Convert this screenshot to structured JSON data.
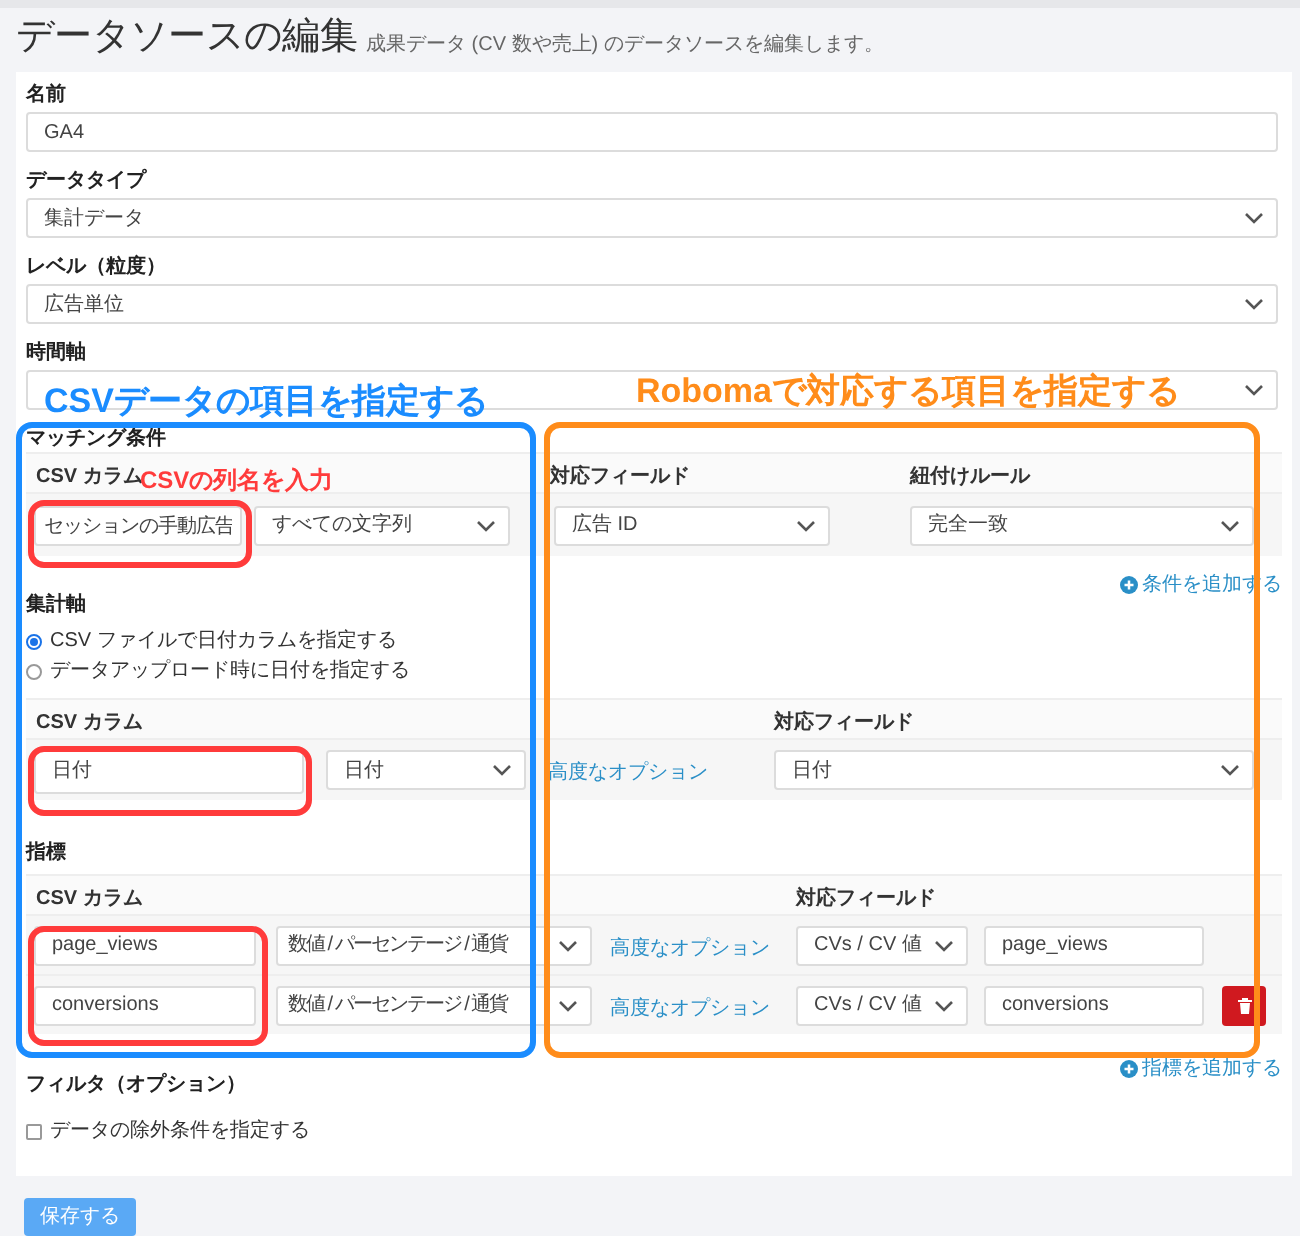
{
  "page": {
    "title": "データソースの編集",
    "subtitle": "成果データ (CV 数や売上) のデータソースを編集します。"
  },
  "fields": [
    {
      "label": "名前",
      "kind": "input",
      "value": "GA4"
    },
    {
      "label": "データタイプ",
      "kind": "select",
      "value": "集計データ"
    },
    {
      "label": "レベル（粒度）",
      "kind": "select",
      "value": "広告単位"
    },
    {
      "label": "時間軸",
      "kind": "select"
    }
  ],
  "matching": {
    "label": "マッチング条件",
    "columns": [
      "CSV カラム",
      "対応フィールド",
      "紐付けルール"
    ],
    "row": {
      "csv_column": "セッションの手動広告",
      "csv_type": "すべての文字列",
      "field": "広告 ID",
      "rule": "完全一致"
    },
    "add_link": "条件を追加する"
  },
  "aggregation": {
    "label": "集計軸",
    "options": [
      {
        "label": "CSV ファイルで日付カラムを指定する",
        "selected": true
      },
      {
        "label": "データアップロード時に日付を指定する",
        "selected": false
      }
    ],
    "columns": [
      "CSV カラム",
      "対応フィールド"
    ],
    "row": {
      "csv_column": "日付",
      "csv_type": "日付",
      "advanced_link": "高度なオプション",
      "field": "日付"
    }
  },
  "metrics": {
    "label": "指標",
    "columns": [
      "CSV カラム",
      "対応フィールド"
    ],
    "rows": [
      {
        "csv_column": "page_views",
        "csv_type": "数値 / パーセンテージ / 通貨",
        "advanced_link": "高度なオプション",
        "field_type": "CVs / CV 値",
        "field": "page_views",
        "deletable": false
      },
      {
        "csv_column": "conversions",
        "csv_type": "数値 / パーセンテージ / 通貨",
        "advanced_link": "高度なオプション",
        "field_type": "CVs / CV 値",
        "field": "conversions",
        "deletable": true
      }
    ],
    "add_link": "指標を追加する"
  },
  "filter": {
    "label": "フィルタ（オプション）",
    "option": {
      "label": "データの除外条件を指定する",
      "checked": false
    }
  },
  "save_button": "保存する",
  "annotations": [
    {
      "text": "CSVデータの項目を指定する",
      "color": "#1a8cff"
    },
    {
      "text": "Robomaで対応する項目を指定する",
      "color": "#ff8c1a"
    },
    {
      "text": "CSVの列名を入力",
      "color": "#ff3b3b"
    }
  ]
}
